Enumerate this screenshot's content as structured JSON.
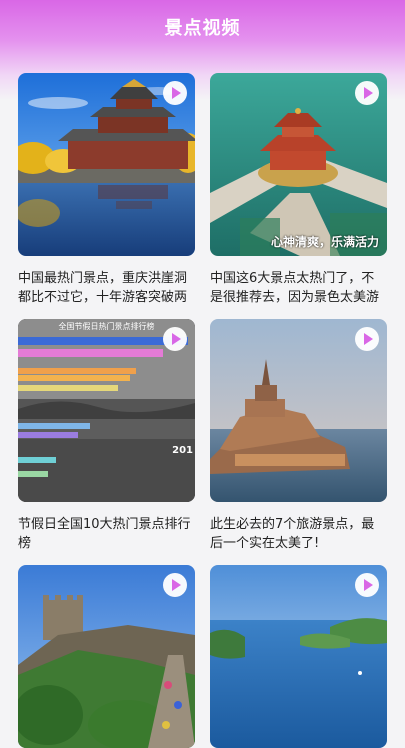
{
  "header": {
    "title": "景点视频"
  },
  "cards": [
    {
      "caption": "中国最热门景点，重庆洪崖洞都比不过它，十年游客突破两"
    },
    {
      "caption": "中国这6大景点太热门了，不是很推荐去，因为景色太美游",
      "overlay": "心神清爽，乐满活力"
    },
    {
      "caption": "节假日全国10大热门景点排行榜",
      "chart_title": "全国节假日热门景点排行榜",
      "chart_year": "201"
    },
    {
      "caption": "此生必去的7个旅游景点，最后一个实在太美了!"
    },
    {
      "caption": ""
    },
    {
      "caption": ""
    }
  ],
  "colors": {
    "header": "#d967e6",
    "background": "#f4f4f6"
  },
  "icons": {
    "play": "play-icon"
  }
}
